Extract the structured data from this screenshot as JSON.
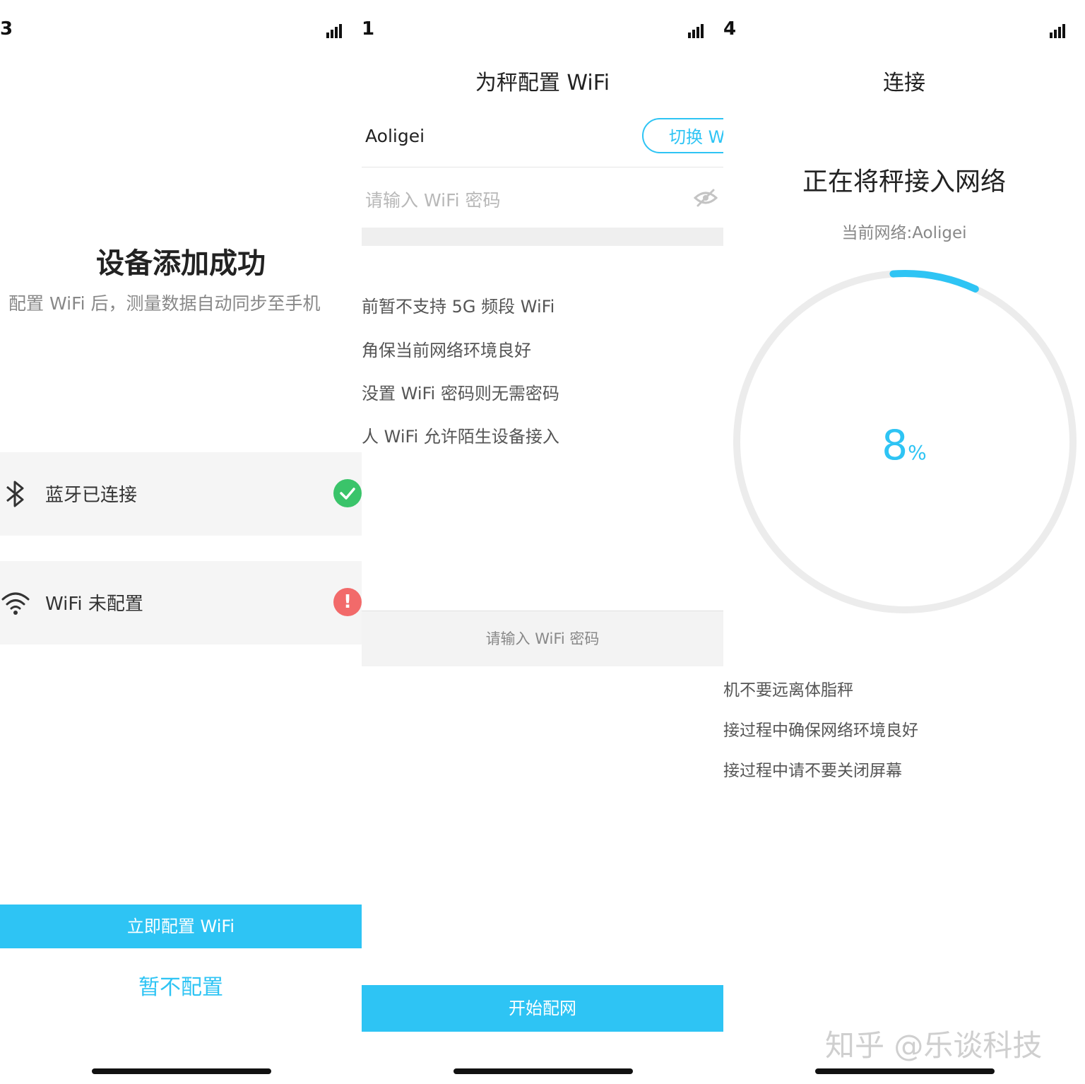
{
  "panel1": {
    "status_time": "3",
    "title": "设备添加成功",
    "subtitle": "配置 WiFi 后，测量数据自动同步至手机",
    "bluetooth_label": "蓝牙已连接",
    "wifi_label": "WiFi 未配置",
    "wifi_badge": "!",
    "primary_button": "立即配置 WiFi",
    "secondary_button": "暂不配置"
  },
  "panel2": {
    "status_time": "1",
    "title": "为秤配置 WiFi",
    "ssid": "Aoligei",
    "switch_button": "切换 W",
    "password_placeholder": "请输入 WiFi 密码",
    "tips": [
      "前暂不支持 5G 频段 WiFi",
      "角保当前网络环境良好",
      "没置 WiFi 密码则无需密码",
      "人 WiFi 允许陌生设备接入"
    ],
    "hint": "请输入 WiFi 密码",
    "start_button": "开始配网"
  },
  "panel3": {
    "status_time": "4",
    "title": "连接",
    "heading": "正在将秤接入网络",
    "network_text": "当前网络:Aoligei",
    "progress_value": "8",
    "progress_unit": "%",
    "progress_fraction": 0.08,
    "tips": [
      "机不要远离体脂秤",
      "接过程中确保网络环境良好",
      "接过程中请不要关闭屏幕"
    ],
    "watermark": "知乎 @乐谈科技"
  },
  "colors": {
    "accent": "#2ec4f4",
    "success": "#3ac46a",
    "error": "#f26a6a",
    "row_bg": "#f5f5f5"
  }
}
